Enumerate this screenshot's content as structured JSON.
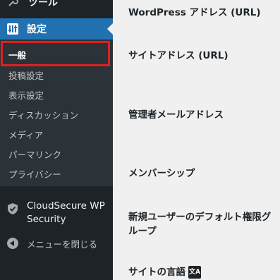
{
  "sidebar": {
    "tools_label": "ツール",
    "settings_label": "設定",
    "settings_icon": "sliders-icon",
    "submenu": [
      {
        "label": "一般",
        "current": true
      },
      {
        "label": "投稿設定"
      },
      {
        "label": "表示設定"
      },
      {
        "label": "ディスカッション"
      },
      {
        "label": "メディア"
      },
      {
        "label": "パーマリンク"
      },
      {
        "label": "プライバシー"
      }
    ],
    "cloudsecure_label_line1": "CloudSecure WP",
    "cloudsecure_label_line2": "Security",
    "collapse_label": "メニューを閉じる"
  },
  "main": {
    "wp_address_label": "WordPress アドレス (URL)",
    "site_address_label": "サイトアドレス (URL)",
    "admin_email_label": "管理者メールアドレス",
    "membership_label": "メンバーシップ",
    "default_role_label_line1": "新規ユーザーのデフォルト権限グ",
    "default_role_label_line2": "ループ",
    "site_language_label": "サイトの言語"
  },
  "colors": {
    "sidebar_bg": "#1d2327",
    "submenu_bg": "#2c3338",
    "accent": "#2271b1",
    "highlight": "#e01f1f",
    "content_bg": "#f0f0f1"
  }
}
